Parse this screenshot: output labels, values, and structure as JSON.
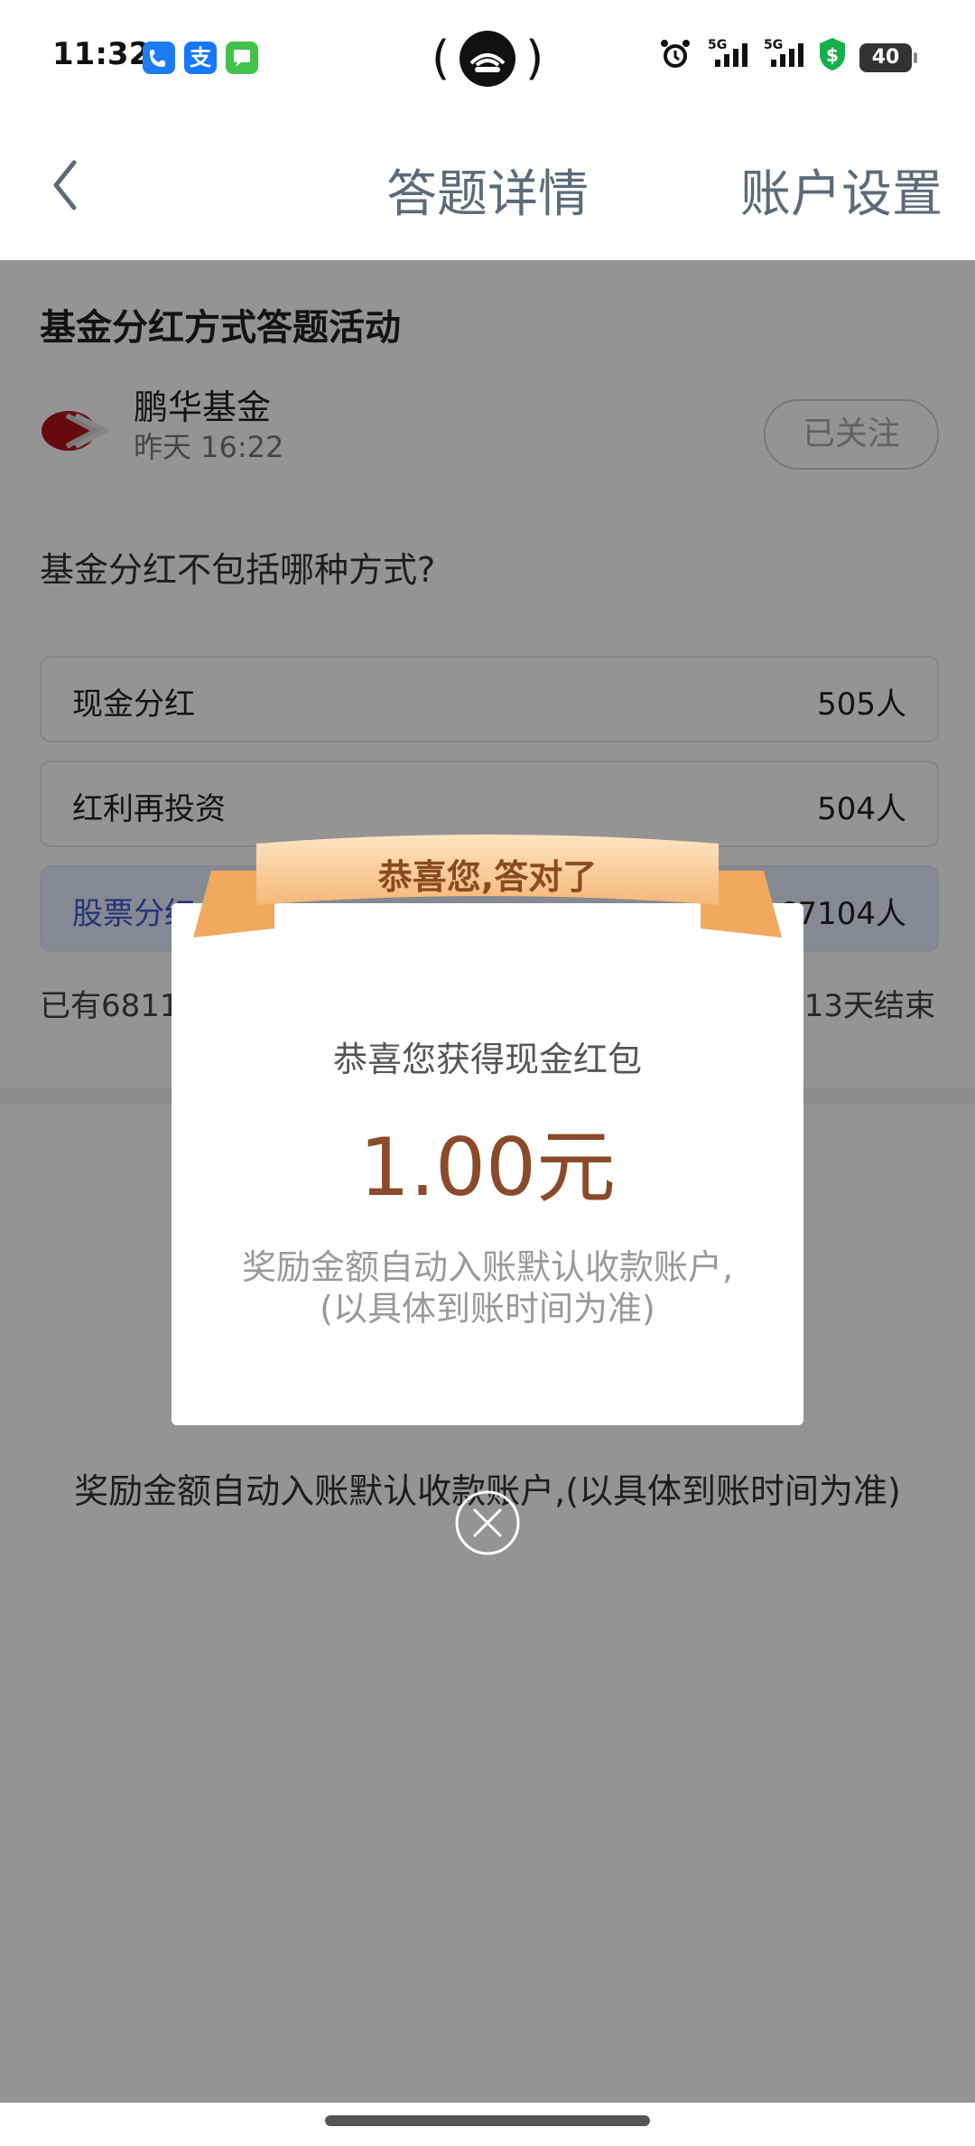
{
  "status_bar": {
    "time": "11:32",
    "battery": "40",
    "icons": [
      "phone-app-icon",
      "alipay-icon",
      "message-icon",
      "hotspot-icon",
      "alarm-icon",
      "signal-5g-icon",
      "signal-5g-icon",
      "wallet-icon"
    ]
  },
  "header": {
    "title": "答题详情",
    "right_action": "账户设置"
  },
  "activity": {
    "title": "基金分红方式答题活动",
    "org_name": "鹏华基金",
    "time": "昨天 16:22",
    "follow_label": "已关注",
    "question": "基金分红不包括哪种方式?",
    "options": [
      {
        "label": "现金分红",
        "count": "505人",
        "selected": false
      },
      {
        "label": "红利再投资",
        "count": "504人",
        "selected": false
      },
      {
        "label": "股票分红",
        "count": "67104人",
        "selected": true
      }
    ],
    "participants_text": "已有6811",
    "ends_text": "13天结束",
    "reward_note": "奖励金额自动入账默认收款账户,(以具体到账时间为准)"
  },
  "modal": {
    "ribbon_text": "恭喜您,答对了",
    "subtitle": "恭喜您获得现金红包",
    "amount": "1.00元",
    "note_line1": "奖励金额自动入账默认收款账户,",
    "note_line2": "(以具体到账时间为准)"
  },
  "colors": {
    "accent_blue": "#3b5bd6",
    "amount_brown": "#8b4a2a",
    "ribbon_orange": "#f5b878"
  }
}
